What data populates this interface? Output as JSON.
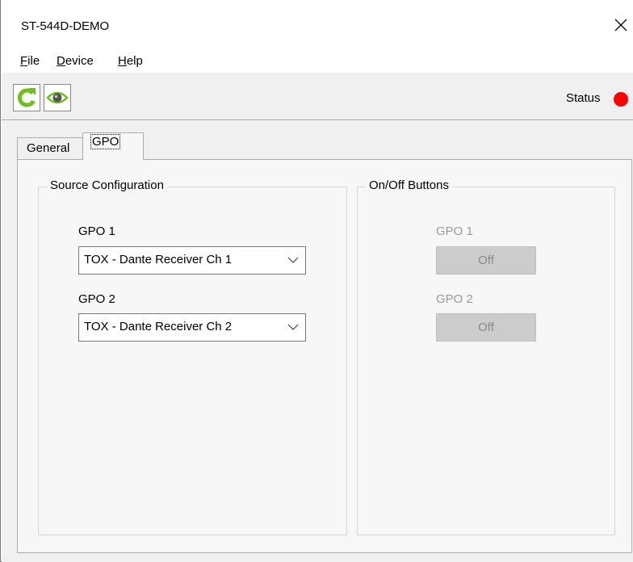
{
  "window": {
    "title": "ST-544D-DEMO"
  },
  "menu": {
    "file": "File",
    "device": "Device",
    "help": "Help"
  },
  "toolbar": {
    "refresh_icon": "refresh-icon",
    "view_icon": "eye-icon",
    "status_label": "Status",
    "status_color": "#ff0000"
  },
  "tabs": [
    {
      "label": "General"
    },
    {
      "label": "GPO"
    }
  ],
  "source_config": {
    "title": "Source Configuration",
    "gpo1_label": "GPO 1",
    "gpo1_value": "TOX - Dante Receiver Ch 1",
    "gpo2_label": "GPO 2",
    "gpo2_value": "TOX - Dante Receiver Ch 2"
  },
  "onoff": {
    "title": "On/Off Buttons",
    "gpo1_label": "GPO 1",
    "gpo1_button": "Off",
    "gpo2_label": "GPO 2",
    "gpo2_button": "Off"
  }
}
